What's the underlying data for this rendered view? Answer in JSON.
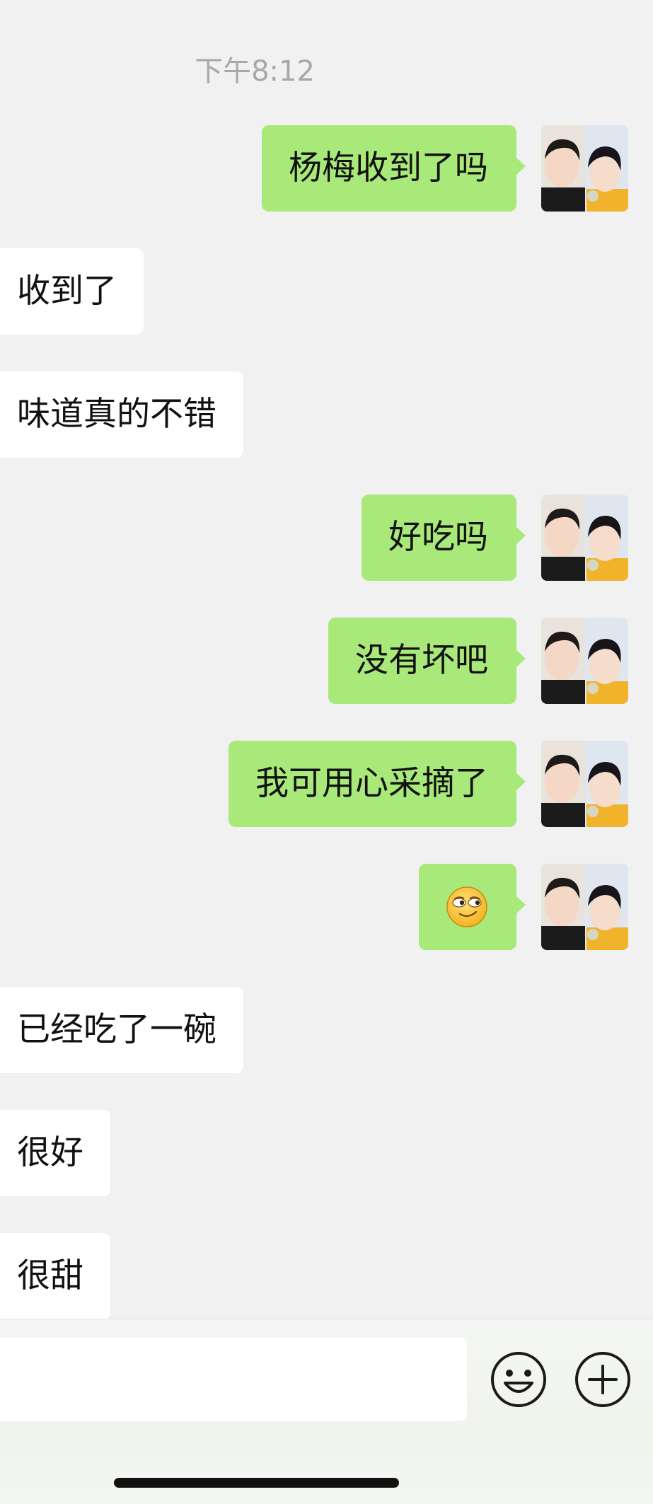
{
  "chat": {
    "timestamp": "下午8:12",
    "messages": [
      {
        "side": "out",
        "text": "杨梅收到了吗"
      },
      {
        "side": "in",
        "text": "收到了"
      },
      {
        "side": "in",
        "text": "味道真的不错"
      },
      {
        "side": "out",
        "text": "好吃吗"
      },
      {
        "side": "out",
        "text": "没有坏吧"
      },
      {
        "side": "out",
        "text": "我可用心采摘了"
      },
      {
        "side": "out",
        "emoji": "smirk-face-emoji"
      },
      {
        "side": "in",
        "text": "已经吃了一碗"
      },
      {
        "side": "in",
        "text": "很好"
      },
      {
        "side": "in",
        "text": "很甜"
      }
    ]
  },
  "input_bar": {
    "message_value": "",
    "emoji_icon": "smiley-face-icon",
    "more_icon": "plus-circle-icon"
  },
  "colors": {
    "background": "#f1f1f1",
    "outgoing_bubble": "#a9e97a",
    "incoming_bubble": "#ffffff",
    "timestamp": "#a8a8a8"
  }
}
